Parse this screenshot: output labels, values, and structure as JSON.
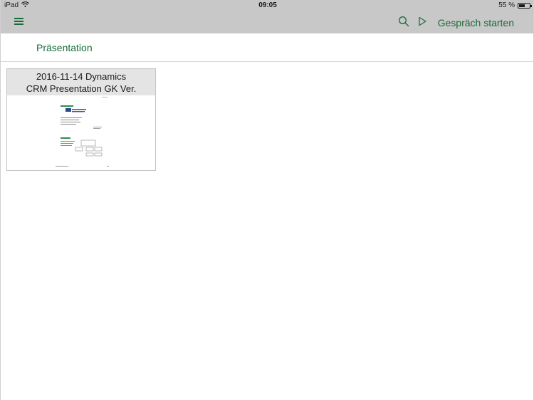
{
  "status_bar": {
    "device": "iPad",
    "time": "09:05",
    "battery": "55 %",
    "battery_level": 0.55
  },
  "nav_bar": {
    "menu_icon": "hamburger-menu-icon",
    "search_icon": "search-icon",
    "play_icon": "play-icon",
    "start_button_label": "Gespräch starten",
    "accent_color": "#1a6b3a"
  },
  "section": {
    "title": "Präsentation"
  },
  "documents": [
    {
      "title_line_1": "2016-11-14 Dynamics",
      "title_line_2": "CRM Presentation GK Ver."
    }
  ],
  "colors": {
    "toolbar_background": "#c8c8c8",
    "tile_header_background": "#e4e4e4",
    "accent": "#1a6b3a"
  }
}
